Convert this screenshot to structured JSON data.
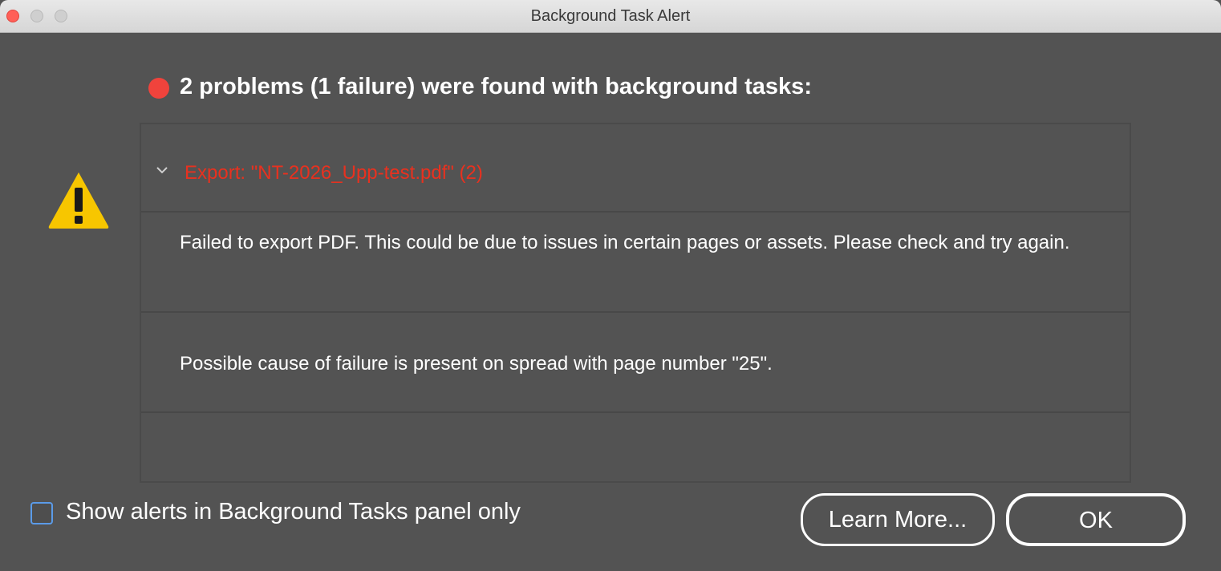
{
  "window": {
    "title": "Background Task Alert"
  },
  "header": {
    "status_color": "#f0433c",
    "headline": "2 problems (1 failure) were found with background tasks:"
  },
  "alert_icon": "warning-triangle-icon",
  "task": {
    "label": "Export: \"NT-2026_Upp-test.pdf\" (2)",
    "label_color": "#e8311f",
    "expanded": true,
    "messages": [
      "Failed to export PDF. This could be due to issues in certain pages or assets. Please check and try again.",
      "Possible cause of failure is present on spread with page number \"25\"."
    ]
  },
  "footer": {
    "checkbox_label": "Show alerts in Background Tasks panel only",
    "checkbox_checked": false,
    "learn_more_label": "Learn More...",
    "ok_label": "OK"
  }
}
